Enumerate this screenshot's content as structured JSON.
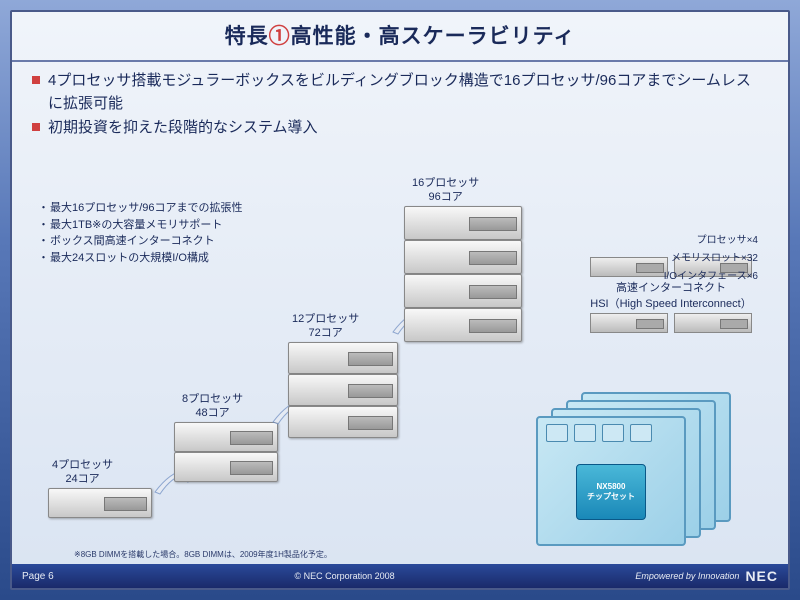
{
  "title_prefix": "特長",
  "title_num": "①",
  "title_main": "高性能・高スケーラビリティ",
  "bullets": [
    "4プロセッサ搭載モジュラーボックスをビルディングブロック構造で16プロセッサ/96コアまでシームレスに拡張可能",
    "初期投資を抑えた段階的なシステム導入"
  ],
  "sub_bullets": [
    "最大16プロセッサ/96コアまでの拡張性",
    "最大1TB※の大容量メモリサポート",
    "ボックス間高速インターコネクト",
    "最大24スロットの大規模I/O構成"
  ],
  "stacks": [
    {
      "proc": "4プロセッサ",
      "cores": "24コア"
    },
    {
      "proc": "8プロセッサ",
      "cores": "48コア"
    },
    {
      "proc": "12プロセッサ",
      "cores": "72コア"
    },
    {
      "proc": "16プロセッサ",
      "cores": "96コア"
    }
  ],
  "hsi": {
    "label1": "高速インターコネクト",
    "label2": "HSI（High Speed Interconnect）"
  },
  "chipset": {
    "chip_line1": "NX5800",
    "chip_line2": "チップセット",
    "labels": {
      "proc": "プロセッサ×4",
      "mem": "メモリスロット×32",
      "io": "I/Oインタフェース×6"
    }
  },
  "footnote": "※8GB DIMMを搭載した場合。8GB DIMMは、2009年度1H製品化予定。",
  "footer": {
    "page": "Page 6",
    "copyright": "© NEC Corporation 2008",
    "tagline": "Empowered by Innovation",
    "logo": "NEC"
  }
}
